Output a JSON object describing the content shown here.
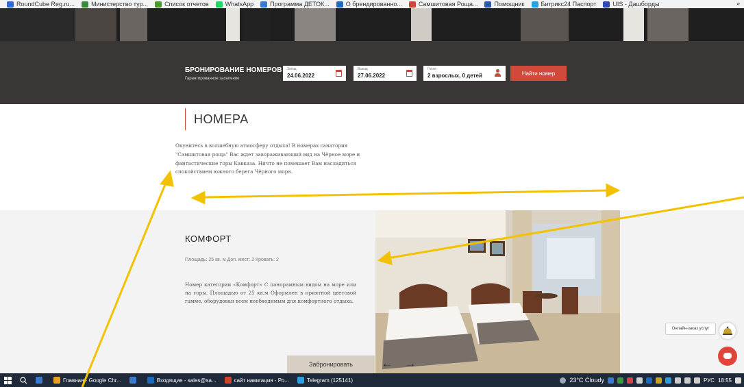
{
  "bookmarks": [
    {
      "label": "RoundCube Reg.ru...",
      "color": "#2d6ad3",
      "icon": "roundcube-icon"
    },
    {
      "label": "Министерство тур...",
      "color": "#3a8a3a",
      "icon": "ministry-icon"
    },
    {
      "label": "Список отчетов",
      "color": "#4a9a2a",
      "icon": "reports-icon"
    },
    {
      "label": "WhatsApp",
      "color": "#25d366",
      "icon": "whatsapp-icon"
    },
    {
      "label": "Программа ДЕТОК...",
      "color": "#3a7ad0",
      "icon": "program-icon"
    },
    {
      "label": "О брендированно...",
      "color": "#1a6ac0",
      "icon": "brand-icon"
    },
    {
      "label": "Самшитовая Роща...",
      "color": "#d0453a",
      "icon": "samshit-icon"
    },
    {
      "label": "Помощник",
      "color": "#2a5ab0",
      "icon": "helper-icon"
    },
    {
      "label": "Битрикс24 Паспорт",
      "color": "#2aa0e0",
      "icon": "bitrix-icon"
    },
    {
      "label": "UIS - Дашборды",
      "color": "#2a4ab0",
      "icon": "uis-icon"
    }
  ],
  "bookmarks_more": "»",
  "booking": {
    "title": "БРОНИРОВАНИЕ НОМЕРОВ",
    "subtitle": "Гарантированное заселение",
    "checkin_label": "Заезд",
    "checkin_value": "24.06.2022",
    "checkout_label": "Выезд",
    "checkout_value": "27.06.2022",
    "guests_label": "Гости",
    "guests_value": "2 взрослых, 0 детей",
    "find_button": "Найти номер"
  },
  "section": {
    "title": "НОМЕРА",
    "text": "Окунитесь в волшебную атмосферу отдыха! В номерах санатория \"Самшитовая роща\" Вас ждет завораживающий вид на Чёрное море и фантастические горы Кавказа. Ничто не помешает Вам насладиться спокойствием южного берега Чёрного моря."
  },
  "room": {
    "title": "КОМФОРТ",
    "meta": "Площадь: 25 кв. м   Доп. мест: 2   Кровать: 2",
    "description": "Номер категории «Комфорт» С панорамным видом на море или на горы. Площадью от 25 кв.м Оформлен в приятной цветовой гамме, оборудован всем необходимым для комфортного отдыха.",
    "book_button": "Забронировать",
    "prev": "←",
    "next": "→"
  },
  "widget": {
    "label": "Онлайн-заказ услуг"
  },
  "taskbar": {
    "items": [
      {
        "label": "Главная - Google Chr...",
        "color": "#e8a020"
      },
      {
        "label": "",
        "color": "#3a7ad0"
      },
      {
        "label": "Входящие - sales@sa...",
        "color": "#1a6ac0"
      },
      {
        "label": "сайт навигация - Ро...",
        "color": "#d0452a"
      },
      {
        "label": "Telegram (125141)",
        "color": "#2aa0e0"
      }
    ],
    "weather": "23°C  Cloudy",
    "lang": "РУС",
    "time": "18:55"
  },
  "colors": {
    "accent": "#d0493a",
    "booking_bg": "#3b3636",
    "room_bg": "#f3f3f3",
    "annotation_arrow": "#f2c200"
  }
}
